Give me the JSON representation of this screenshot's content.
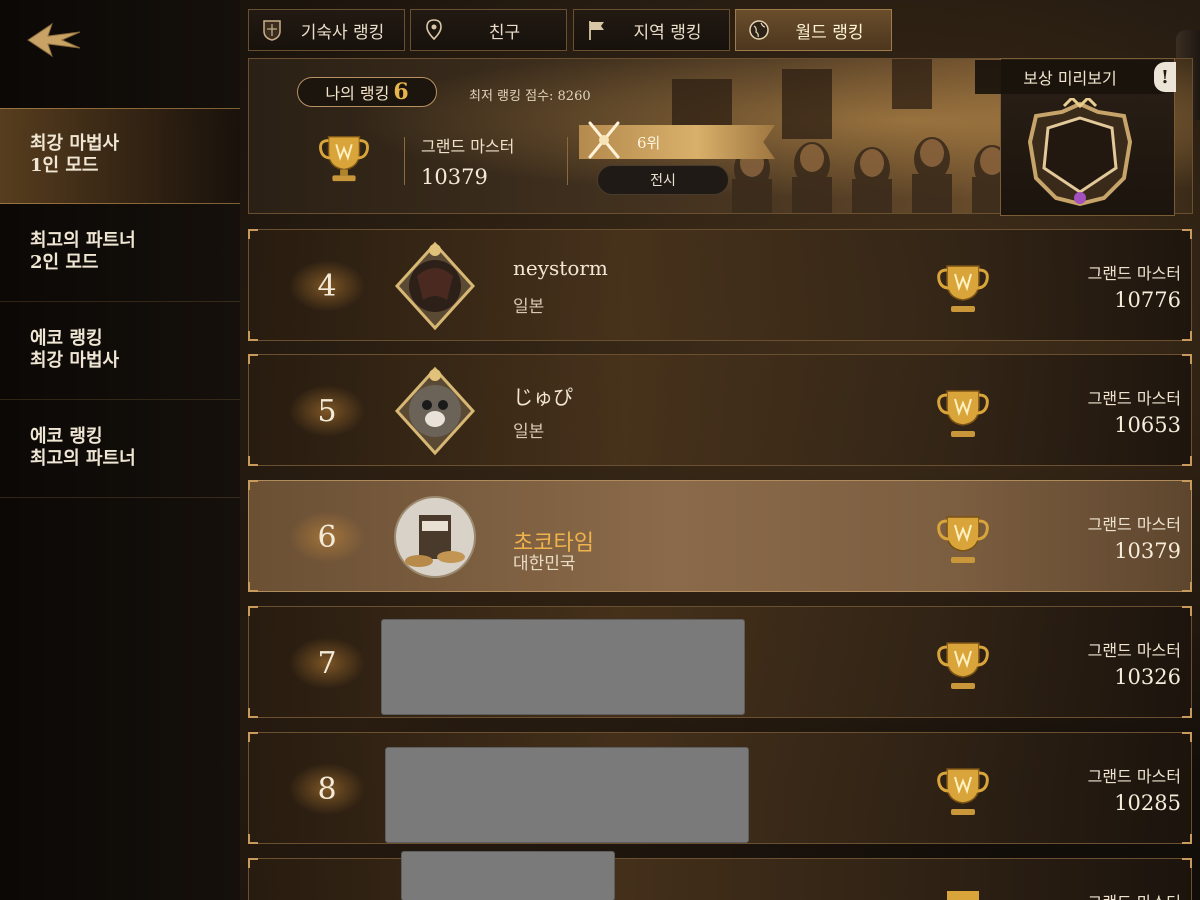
{
  "tabs": [
    {
      "label": "기숙사 랭킹",
      "icon": "house-crest-icon",
      "active": false
    },
    {
      "label": "친구",
      "icon": "location-pin-icon",
      "active": false
    },
    {
      "label": "지역 랭킹",
      "icon": "flag-icon",
      "active": false
    },
    {
      "label": "월드 랭킹",
      "icon": "globe-icon",
      "active": true
    }
  ],
  "sidebar": {
    "items": [
      {
        "line1": "최강 마법사",
        "line2": "1인 모드",
        "active": true
      },
      {
        "line1": "최고의 파트너",
        "line2": "2인 모드",
        "active": false
      },
      {
        "line1": "에코 랭킹",
        "line2": "최강 마법사",
        "active": false
      },
      {
        "line1": "에코 랭킹",
        "line2": "최고의 파트너",
        "active": false
      }
    ]
  },
  "my_rank": {
    "label": "나의 랭킹",
    "rank": "6",
    "min_score_label": "최저 랭킹 점수: 8260",
    "tier": "그랜드 마스터",
    "score": "10379",
    "place": "6위",
    "show_button": "전시"
  },
  "reward": {
    "title": "보상 미리보기",
    "alert": "!"
  },
  "rows": [
    {
      "rank": "4",
      "name": "neystorm",
      "country": "일본",
      "tier": "그랜드 마스터",
      "score": "10776"
    },
    {
      "rank": "5",
      "name": "じゅぴ",
      "country": "일본",
      "tier": "그랜드 마스터",
      "score": "10653"
    },
    {
      "rank": "6",
      "name": "초코타임",
      "country": "대한민국",
      "tier": "그랜드 마스터",
      "score": "10379"
    },
    {
      "rank": "7",
      "name": "",
      "country": "",
      "tier": "그랜드 마스터",
      "score": "10326"
    },
    {
      "rank": "8",
      "name": "",
      "country": "",
      "tier": "그랜드 마스터",
      "score": "10285"
    },
    {
      "rank": "",
      "name": "",
      "country": "",
      "tier": "그랜드 마스터",
      "score": ""
    }
  ],
  "colors": {
    "accent_gold": "#e6b64d",
    "highlight_name": "#f0b24a",
    "frame_border": "#6a5030"
  }
}
